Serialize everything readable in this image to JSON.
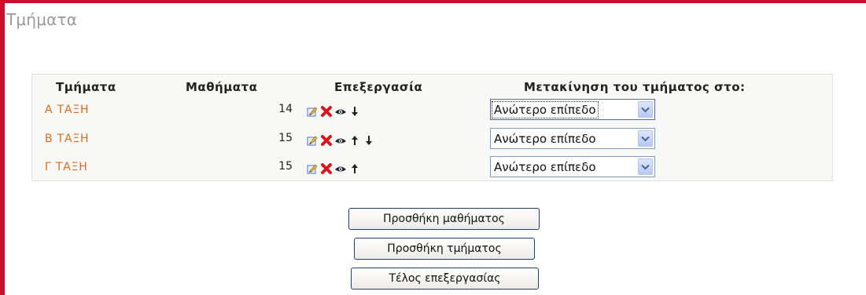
{
  "page": {
    "title": "Τμήματα"
  },
  "table": {
    "headers": {
      "category": "Τμήματα",
      "courses": "Μαθήματα",
      "edit": "Επεξεργασία",
      "move": "Μετακίνηση του τμήματος στο:"
    },
    "rows": [
      {
        "name": "Α ΤΑΞΗ",
        "courses": "14",
        "icons": [
          "edit-icon",
          "delete-icon",
          "visibility-eye-icon",
          "move-down-icon"
        ],
        "move_to": "Ανώτερο επίπεδο"
      },
      {
        "name": "Β ΤΑΞΗ",
        "courses": "15",
        "icons": [
          "edit-icon",
          "delete-icon",
          "visibility-eye-icon",
          "move-up-icon",
          "move-down-icon"
        ],
        "move_to": "Ανώτερο επίπεδο"
      },
      {
        "name": "Γ ΤΑΞΗ",
        "courses": "15",
        "icons": [
          "edit-icon",
          "delete-icon",
          "visibility-eye-icon",
          "move-up-icon"
        ],
        "move_to": "Ανώτερο επίπεδο"
      }
    ]
  },
  "buttons": {
    "add_course": "Προσθήκη μαθήματος",
    "add_category": "Προσθήκη τμήματος",
    "finish_editing": "Τέλος επεξεργασίας"
  },
  "colors": {
    "frame": "#c8102e",
    "link": "#d86b1f",
    "heading": "#9a9a9a"
  }
}
